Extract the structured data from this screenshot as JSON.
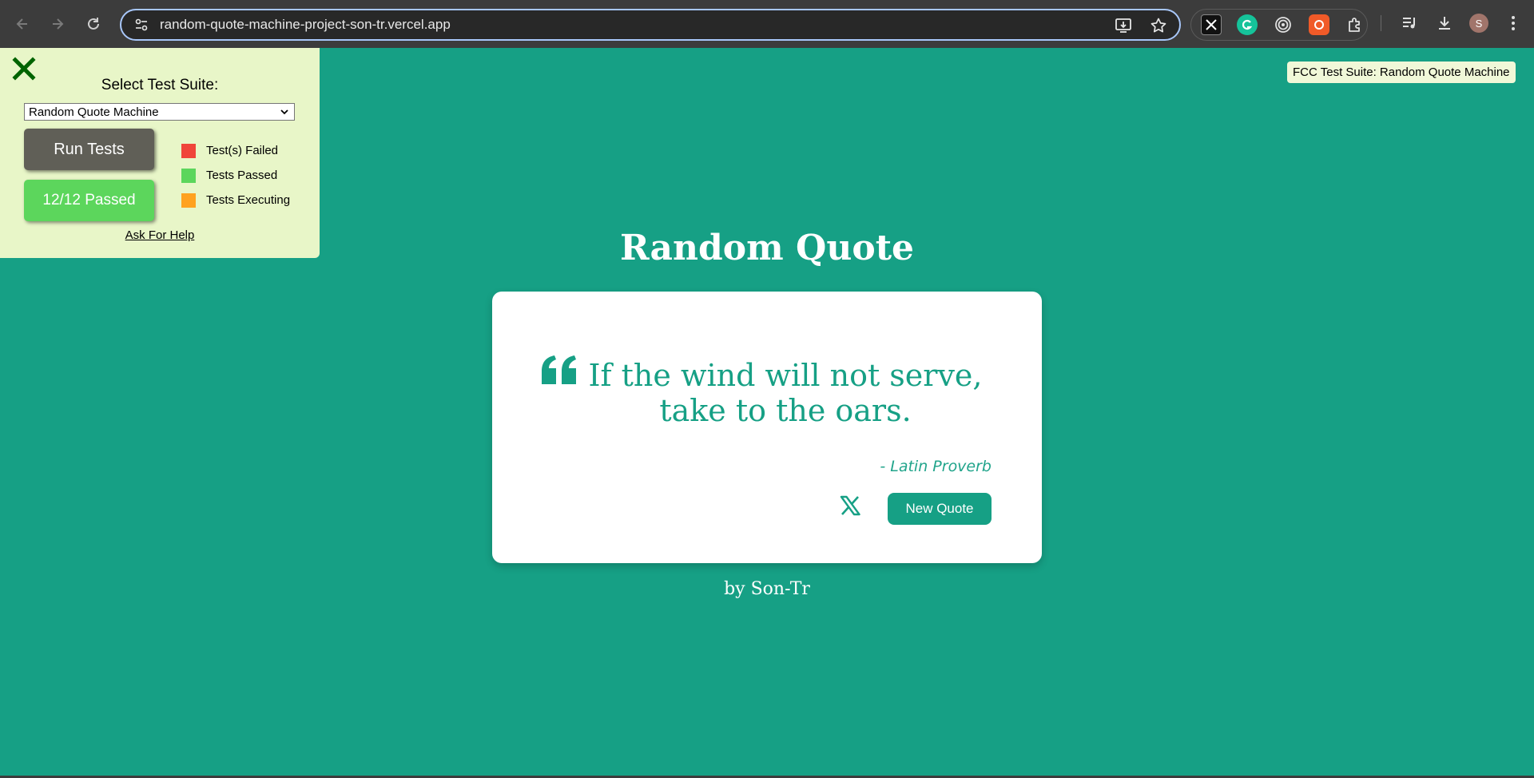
{
  "browser": {
    "url": "random-quote-machine-project-son-tr.vercel.app",
    "avatar_letter": "S"
  },
  "fcc": {
    "select_label": "Select Test Suite:",
    "selected_suite": "Random Quote Machine",
    "run_label": "Run Tests",
    "passed_label": "12/12 Passed",
    "legend": [
      {
        "label": "Test(s) Failed",
        "color": "#f0453a"
      },
      {
        "label": "Tests Passed",
        "color": "#5cd65c"
      },
      {
        "label": "Tests Executing",
        "color": "#ffa21f"
      }
    ],
    "help_label": "Ask For Help",
    "tag_label": "FCC Test Suite: Random Quote Machine"
  },
  "page": {
    "title": "Random Quote",
    "quote_line1": "If the wind will not serve,",
    "quote_line2": "take to the oars.",
    "author": "- Latin Proverb",
    "new_quote_label": "New Quote",
    "byline": "by Son-Tr"
  },
  "colors": {
    "accent": "#16a085",
    "panel_bg": "#e8f6c8"
  }
}
